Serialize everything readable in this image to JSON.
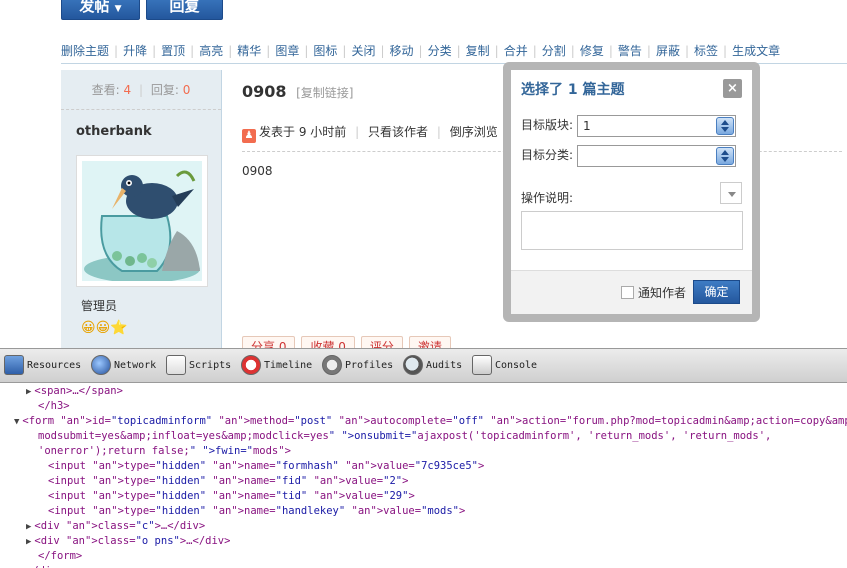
{
  "forum": {
    "post_button": "发帖",
    "reply_button": "回复",
    "mod_actions": [
      "删除主题",
      "升降",
      "置顶",
      "高亮",
      "精华",
      "图章",
      "图标",
      "关闭",
      "移动",
      "分类",
      "复制",
      "合并",
      "分割",
      "修复",
      "警告",
      "屏蔽",
      "标签",
      "生成文章"
    ],
    "stats": {
      "views_label": "查看:",
      "views": "4",
      "replies_label": "回复:",
      "replies": "0"
    },
    "username": "otherbank",
    "usergroup": "管理员",
    "stars": "😀😀⭐",
    "post_title": "0908",
    "copy_link": "[复制链接]",
    "meta": {
      "posted": "发表于 9 小时前",
      "author_only": "只看该作者",
      "reverse": "倒序浏览"
    },
    "post_body": "0908",
    "actions": [
      "分享 0",
      "收藏 0",
      "评分",
      "邀请"
    ]
  },
  "popup": {
    "title": "选择了 1 篇主题",
    "target_forum_label": "目标版块:",
    "target_forum_value": "1",
    "target_category_label": "目标分类:",
    "target_category_value": "",
    "reason_label": "操作说明:",
    "notify_label": "通知作者",
    "confirm": "确定"
  },
  "devtools": {
    "tabs": [
      "Resources",
      "Network",
      "Scripts",
      "Timeline",
      "Profiles",
      "Audits",
      "Console"
    ],
    "lines": [
      {
        "indent": 38,
        "tri": "▶",
        "text": "<span>…</span>"
      },
      {
        "indent": 38,
        "tri": "",
        "text": "</h3>"
      },
      {
        "indent": 26,
        "tri": "▼",
        "text": "<form id=\"topicadminform\" method=\"post\" autocomplete=\"off\" action=\"forum.php?mod=topicadmin&amp;action=copy&amp;"
      },
      {
        "indent": 38,
        "tri": "",
        "text": "modsubmit=yes&amp;infloat=yes&amp;modclick=yes\" onsubmit=\"ajaxpost('topicadminform', 'return_mods', 'return_mods',"
      },
      {
        "indent": 38,
        "tri": "",
        "text": "'onerror');return false;\" fwin=\"mods\">"
      },
      {
        "indent": 48,
        "tri": "",
        "text": "<input type=\"hidden\" name=\"formhash\" value=\"7c935ce5\">"
      },
      {
        "indent": 48,
        "tri": "",
        "text": "<input type=\"hidden\" name=\"fid\" value=\"2\">"
      },
      {
        "indent": 48,
        "tri": "",
        "text": "<input type=\"hidden\" name=\"tid\" value=\"29\">"
      },
      {
        "indent": 48,
        "tri": "",
        "text": "<input type=\"hidden\" name=\"handlekey\" value=\"mods\">"
      },
      {
        "indent": 38,
        "tri": "▶",
        "text": "<div class=\"c\">…</div>"
      },
      {
        "indent": 38,
        "tri": "▶",
        "text": "<div class=\"o pns\">…</div>"
      },
      {
        "indent": 38,
        "tri": "",
        "text": "</form>"
      },
      {
        "indent": 26,
        "tri": "",
        "text": "</div>"
      }
    ]
  }
}
